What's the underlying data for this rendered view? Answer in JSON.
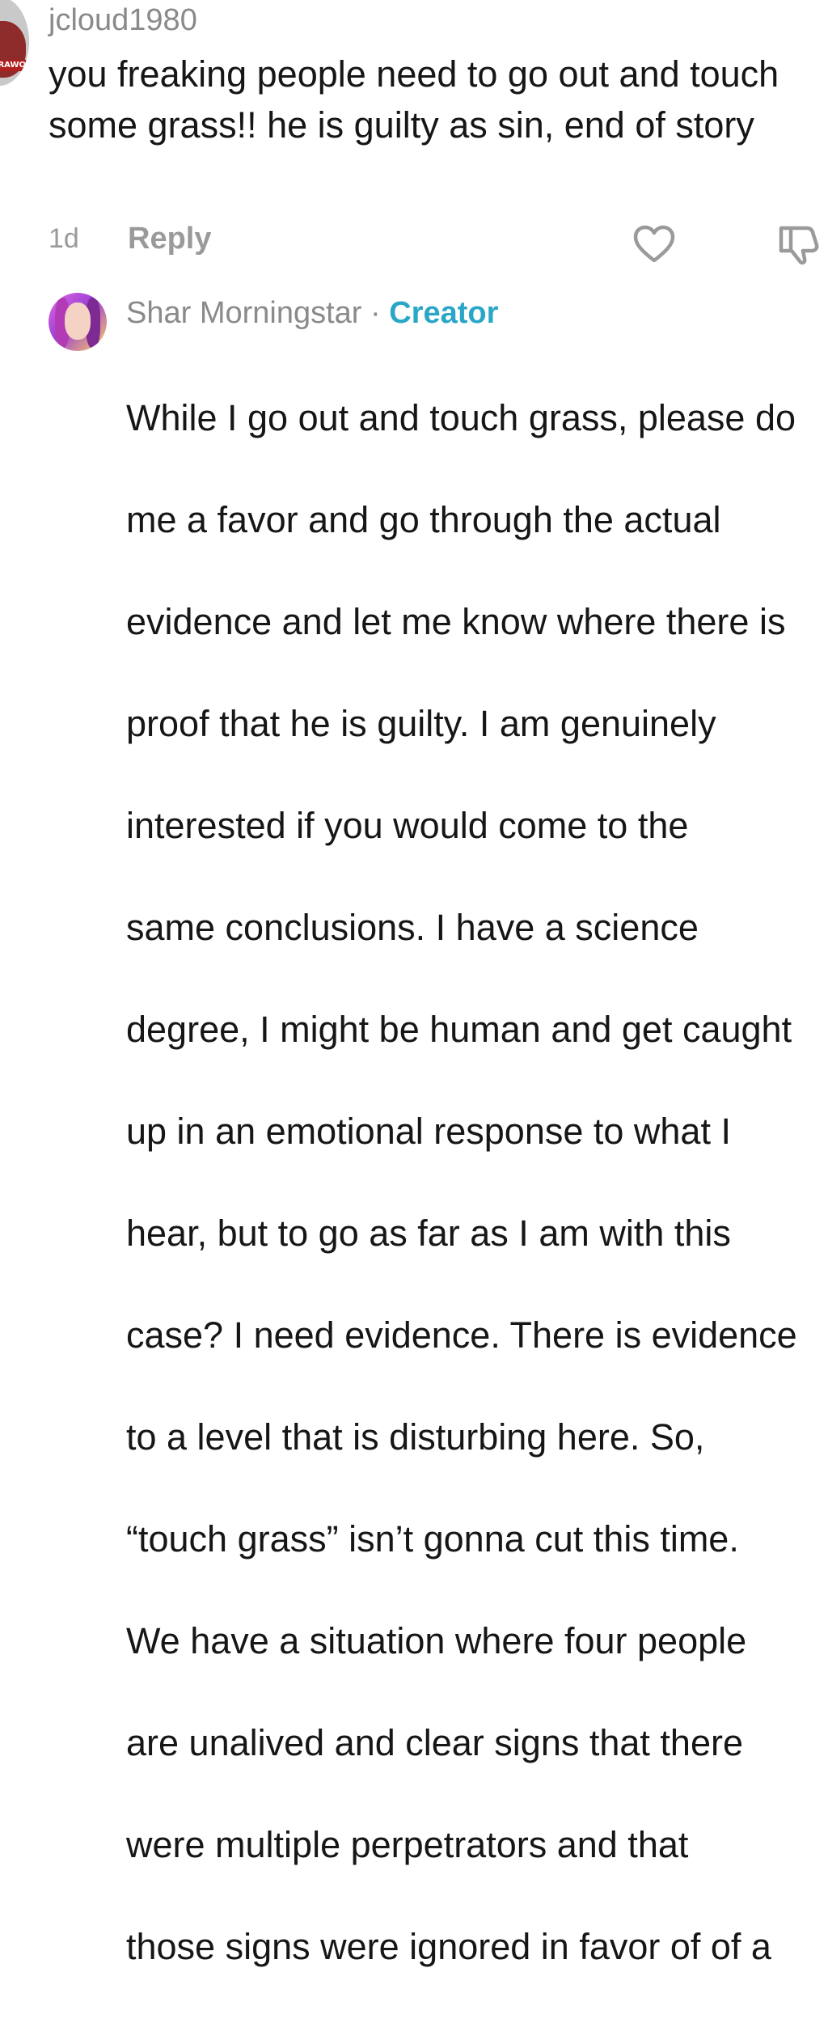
{
  "comment": {
    "username": "jcloud1980",
    "avatar_badge_text": "RAWO",
    "text": "you freaking people need to go out and touch some grass!! he is guilty as sin, end of story",
    "time": "1d",
    "reply_label": "Reply",
    "like_icon": "heart-icon",
    "dislike_icon": "dislike-icon"
  },
  "reply": {
    "username": "Shar Morningstar",
    "separator": "·",
    "badge": "Creator",
    "badge_color": "#2aa6c7",
    "text_lines": [
      "While I go out and touch grass, please do",
      "me a favor and go through the actual",
      "evidence and let me know where there is",
      "proof that he is guilty. I am genuinely",
      "interested if you would come to the",
      "same conclusions. I have a science",
      "degree, I might be human and get caught",
      "up in an emotional response to what I",
      "hear, but to go as far as I am with this",
      "case? I need evidence. There is evidence",
      "to a level that is disturbing here. So,",
      "“touch grass” isn’t gonna cut this time.",
      "We have a situation where four people",
      "are unalived and clear signs that there",
      "were multiple perpetrators and that",
      "those signs were ignored in favor of of a"
    ]
  },
  "colors": {
    "muted_text": "#8a8a8a",
    "body_text": "#161616",
    "creator_accent": "#2aa6c7"
  }
}
